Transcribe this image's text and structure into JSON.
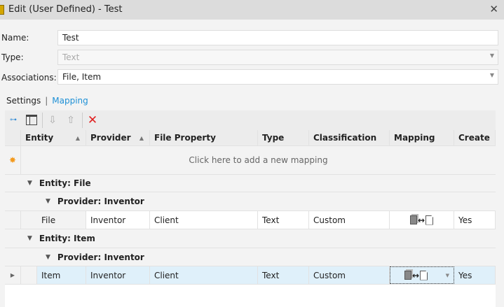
{
  "window": {
    "title": "Edit (User Defined) - Test",
    "close": "✕"
  },
  "form": {
    "name_label": "Name:",
    "name_value": "Test",
    "type_label": "Type:",
    "type_value": "Text",
    "assoc_label": "Associations:",
    "assoc_value": "File, Item"
  },
  "tabs": {
    "settings": "Settings",
    "separator": "|",
    "mapping": "Mapping"
  },
  "toolbar": {
    "delete": "✕"
  },
  "grid": {
    "columns": [
      "Entity",
      "Provider",
      "File Property",
      "Type",
      "Classification",
      "Mapping",
      "Create"
    ],
    "new_row": "Click here to add a new mapping",
    "groups": [
      {
        "entity": "Entity: File",
        "provider": "Provider: Inventor",
        "row": [
          "File",
          "Inventor",
          "Client",
          "Text",
          "Custom",
          "Yes"
        ]
      },
      {
        "entity": "Entity: Item",
        "provider": "Provider: Inventor",
        "row": [
          "Item",
          "Inventor",
          "Client",
          "Text",
          "Custom",
          "Yes"
        ]
      }
    ]
  },
  "colors": {
    "accent": "#1e90d6",
    "selected_row": "#dff0fa",
    "delete": "#e02020"
  }
}
